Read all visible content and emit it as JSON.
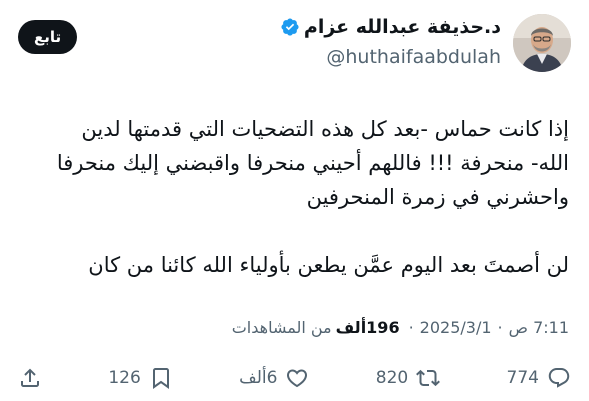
{
  "author": {
    "display_name": "د.حذيفة عبدالله عزام",
    "handle": "@huthaifaabdulah",
    "verified": true
  },
  "follow_button": {
    "label": "تابع"
  },
  "tweet": {
    "lines_para1": [
      "إذا كانت حماس -بعد كل هذه التضحيات التي قدمتها لدين",
      "الله- منحرفة !!! فاللهم أحيني منحرفا واقبضني إليك منحرفا",
      "واحشرني في زمرة المنحرفين"
    ],
    "lines_para2": [
      "لن أصمتَ بعد اليوم عمَّن يطعن بأولياء الله كائنا من كان"
    ]
  },
  "meta": {
    "time": "7:11 ص",
    "date": "2025/3/1",
    "views_count": "196ألف",
    "views_label": "من المشاهدات"
  },
  "actions": {
    "reply_count": "774",
    "retweet_count": "820",
    "like_count": "6ألف",
    "bookmark_count": "126"
  },
  "colors": {
    "text": "#0f1419",
    "secondary": "#536471",
    "verified": "#1d9bf0",
    "follow_bg": "#0f1419"
  },
  "icons": {
    "verified": "verified-badge-icon",
    "reply": "reply-icon",
    "retweet": "retweet-icon",
    "like": "heart-icon",
    "bookmark": "bookmark-icon",
    "share": "share-icon"
  }
}
